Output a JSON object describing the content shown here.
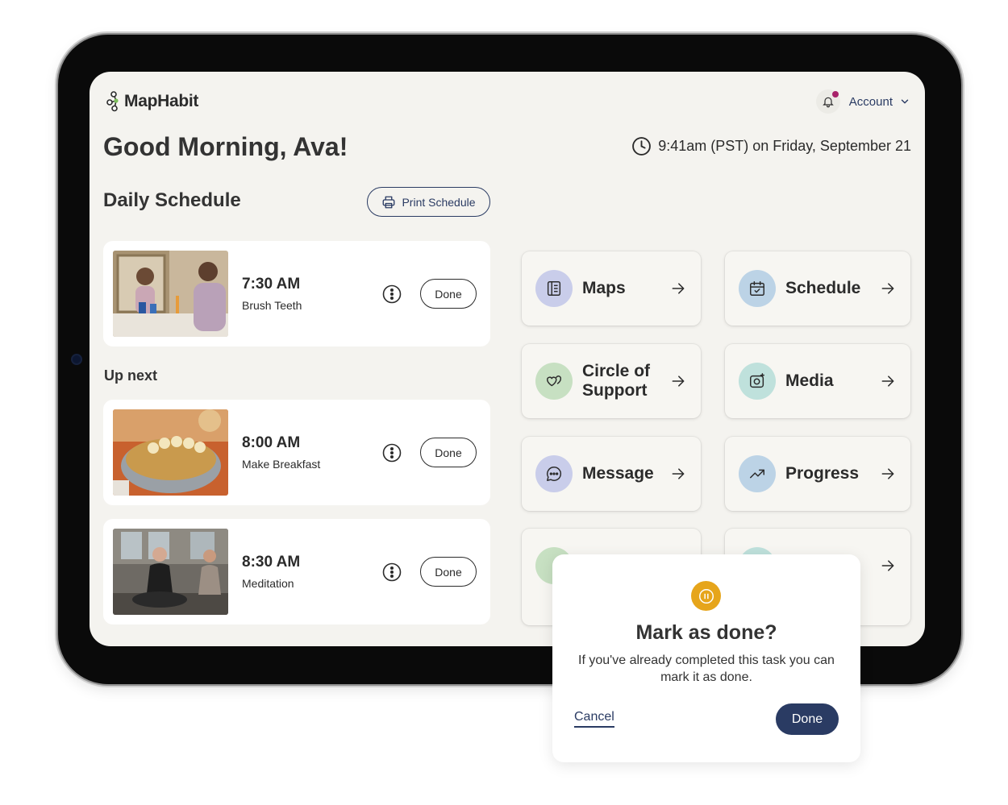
{
  "app": {
    "name": "MapHabit"
  },
  "header": {
    "account_label": "Account"
  },
  "greeting": "Good Morning, Ava!",
  "datetime": "9:41am (PST) on Friday, September 21",
  "schedule": {
    "title": "Daily Schedule",
    "print_label": "Print Schedule",
    "up_next_label": "Up next",
    "items": [
      {
        "time": "7:30 AM",
        "task": "Brush Teeth",
        "done_label": "Done",
        "image": "person-brushing-teeth-at-mirror"
      },
      {
        "time": "8:00 AM",
        "task": "Make Breakfast",
        "done_label": "Done",
        "image": "bowl-of-cereal-with-bananas"
      },
      {
        "time": "8:30 AM",
        "task": "Meditation",
        "done_label": "Done",
        "image": "group-meditation-class"
      }
    ]
  },
  "nav_tiles": [
    {
      "label": "Maps",
      "icon": "book-icon",
      "color": "#c9cdea"
    },
    {
      "label": "Schedule",
      "icon": "calendar-icon",
      "color": "#bcd3e6"
    },
    {
      "label": "Circle of Support",
      "icon": "hearts-icon",
      "color": "#c7e0c2"
    },
    {
      "label": "Media",
      "icon": "camera-icon",
      "color": "#bfe1dc"
    },
    {
      "label": "Message",
      "icon": "chat-icon",
      "color": "#c9cdea"
    },
    {
      "label": "Progress",
      "icon": "trend-up-icon",
      "color": "#bcd3e6"
    }
  ],
  "dialog": {
    "title": "Mark as done?",
    "body": "If you've already completed this task you can mark it as done.",
    "cancel_label": "Cancel",
    "done_label": "Done",
    "icon": "pause-icon",
    "icon_color": "#e6a51b"
  },
  "colors": {
    "primary": "#2a3b63",
    "background": "#f4f3ef",
    "notification": "#a8236a"
  }
}
